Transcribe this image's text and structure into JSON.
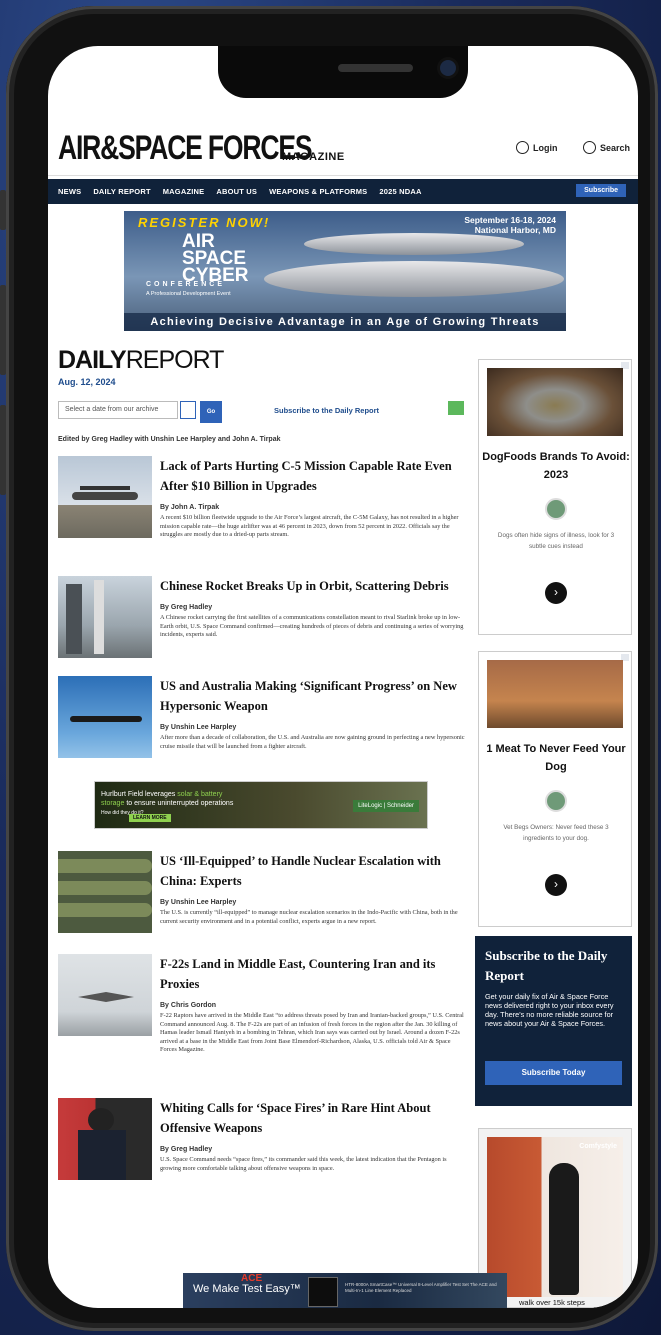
{
  "site": {
    "logo_main": "AIR&SPACE FORCES",
    "logo_sub": "MAGAZINE",
    "login": "Login",
    "search": "Search",
    "subscribe": "Subscribe"
  },
  "nav": [
    "NEWS",
    "DAILY REPORT",
    "MAGAZINE",
    "ABOUT US",
    "WEAPONS & PLATFORMS",
    "2025 NDAA"
  ],
  "banner_ad": {
    "register": "REGISTER NOW!",
    "dates": "September 16-18, 2024",
    "location": "National Harbor, MD",
    "logo_lines": [
      "AIR",
      "SPACE",
      "CYBER"
    ],
    "conference": "CONFERENCE",
    "prof": "A Professional Development Event",
    "tagline": "Achieving Decisive Advantage in an Age of Growing Threats"
  },
  "page": {
    "title_bold": "DAILY",
    "title_light": "REPORT",
    "date": "Aug. 12, 2024",
    "archive_placeholder": "Select a date from our archive",
    "go": "Go",
    "subscribe_link": "Subscribe to the Daily Report",
    "editors": "Edited by Greg Hadley with Unshin Lee Harpley and John A. Tirpak"
  },
  "articles": [
    {
      "title": "Lack of Parts Hurting C-5 Mission Capable Rate Even After $10 Billion in Upgrades",
      "byline": "By John A. Tirpak",
      "summary": "A recent $10 billion fleetwide upgrade to the Air Force’s largest aircraft, the C-5M Galaxy, has not resulted in a higher mission capable rate—the huge airlifter was at 46 percent in 2023, down from 52 percent in 2022. Officials say the struggles are mostly due to a dried-up parts stream."
    },
    {
      "title": "Chinese Rocket Breaks Up in Orbit, Scattering Debris",
      "byline": "By Greg Hadley",
      "summary": "A Chinese rocket carrying the first satellites of a communications constellation meant to rival Starlink broke up in low-Earth orbit, U.S. Space Command confirmed—creating hundreds of pieces of debris and continuing a series of worrying incidents, experts said."
    },
    {
      "title": "US and Australia Making ‘Significant Progress’ on New Hypersonic Weapon",
      "byline": "By Unshin Lee Harpley",
      "summary": "After more than a decade of collaboration, the U.S. and Australia are now gaining ground in perfecting a new hypersonic cruise missile that will be launched from a fighter aircraft."
    },
    {
      "title": "US ‘Ill-Equipped’ to Handle Nuclear Escalation with China: Experts",
      "byline": "By Unshin Lee Harpley",
      "summary": "The U.S. is currently “ill-equipped” to manage nuclear escalation scenarios in the Indo-Pacific with China, both in the current security environment and in a potential conflict, experts argue in a new report."
    },
    {
      "title": "F-22s Land in Middle East, Countering Iran and its Proxies",
      "byline": "By Chris Gordon",
      "summary": "F-22 Raptors have arrived in the Middle East “to address threats posed by Iran and Iranian-backed groups,” U.S. Central Command announced Aug. 8. The F-22s are part of an infusion of fresh forces in the region after the Jan. 30 killing of Hamas leader Ismail Haniyeh in a bombing in Tehran, which Iran says was carried out by Israel. Around a dozen F-22s arrived at a base in the Middle East from Joint Base Elmendorf-Richardson, Alaska, U.S. officials told Air & Space Forces Magazine."
    },
    {
      "title": "Whiting Calls for ‘Space Fires’ in Rare Hint About Offensive Weapons",
      "byline": "By Greg Hadley",
      "summary": "U.S. Space Command needs “space fires,” its commander said this week, the latest indication that the Pentagon is growing more comfortable talking about offensive weapons in space."
    }
  ],
  "mid_ad": {
    "line1": "Hurlburt Field leverages",
    "line1_green": "solar & battery",
    "line2_green": "storage",
    "line2": "to ensure uninterrupted operations",
    "cta": "How did they do it?",
    "button": "LEARN MORE",
    "logo": "LiteLogic | Schneider"
  },
  "side_ads": [
    {
      "title": "DogFoods Brands To Avoid: 2023",
      "sub": "Dogs often hide signs of illness, look for 3 subtle cues instead"
    },
    {
      "title": "1 Meat To Never Feed Your Dog",
      "sub": "Vet Begs Owners: Never feed these 3 ingredients to your dog."
    }
  ],
  "subscribe_box": {
    "heading": "Subscribe to the Daily Report",
    "text": "Get your daily fix of Air & Space Force news delivered right to your inbox every day. There's no more reliable source for news about your Air & Space Forces.",
    "button": "Subscribe Today"
  },
  "fashion_ad": {
    "brand": "Comfystyle",
    "caption": "walk over 15k steps"
  },
  "bottom_ad": {
    "ace": "ACE",
    "text": "We Make Test Easy™",
    "small": "HTR-8000A SmartCase™ Universal 8-Level Amplifier Test Set The ACE and Multi-In-1 Line Element Replaced"
  }
}
